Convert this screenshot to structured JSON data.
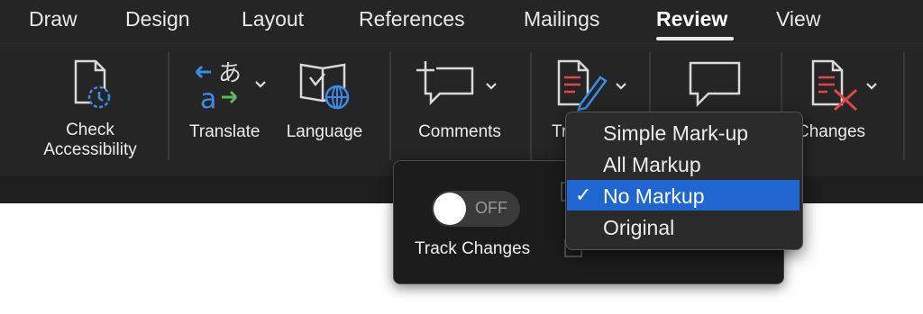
{
  "tabs": [
    {
      "label": "Draw"
    },
    {
      "label": "Design"
    },
    {
      "label": "Layout"
    },
    {
      "label": "References"
    },
    {
      "label": "Mailings"
    },
    {
      "label": "Review",
      "active": true
    },
    {
      "label": "View"
    }
  ],
  "ribbon": {
    "check_accessibility": {
      "line1": "Check",
      "line2": "Accessibility"
    },
    "translate": {
      "label": "Translate"
    },
    "language": {
      "label": "Language"
    },
    "comments": {
      "label": "Comments"
    },
    "tracking": {
      "label_partial": "Tr"
    },
    "changes": {
      "label": "Changes"
    }
  },
  "track_changes_panel": {
    "toggle_state": "OFF",
    "label": "Track Changes"
  },
  "markup_menu": {
    "items": [
      {
        "label": "Simple Mark-up",
        "checked": false
      },
      {
        "label": "All Markup",
        "checked": false
      },
      {
        "label": "No Markup",
        "checked": true
      },
      {
        "label": "Original",
        "checked": false
      }
    ],
    "check_glyph": "✓"
  },
  "colors": {
    "accent_blue": "#1f66d1",
    "icon_red": "#e0474c",
    "icon_blue": "#3b8be8",
    "icon_green": "#5cb85c"
  }
}
